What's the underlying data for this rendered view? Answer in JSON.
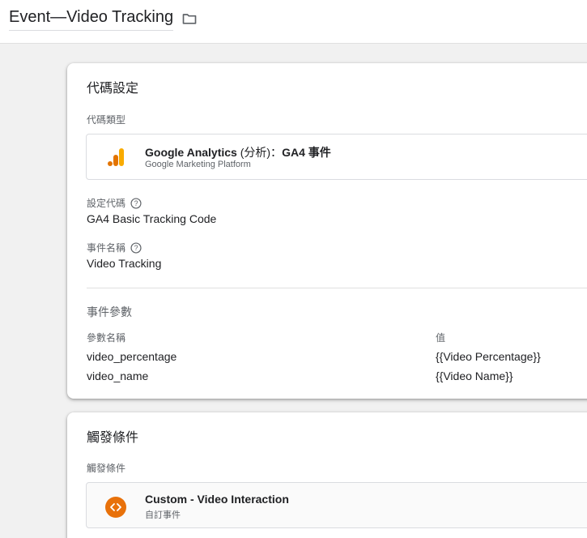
{
  "header": {
    "title": "Event—Video Tracking",
    "folder_icon": "folder-icon"
  },
  "tag_config": {
    "heading": "代碼設定",
    "type_label": "代碼類型",
    "type": {
      "name_bold_1": "Google Analytics ",
      "name_normal": "(分析)：",
      "name_bold_2": "GA4 事件",
      "platform": "Google Marketing Platform",
      "icon": "google-analytics-icon"
    },
    "config_tag_label": "設定代碼",
    "config_tag_value": "GA4 Basic Tracking Code",
    "event_name_label": "事件名稱",
    "event_name_value": "Video Tracking",
    "params": {
      "heading": "事件參數",
      "col_name": "參數名稱",
      "col_value": "值",
      "rows": [
        {
          "name": "video_percentage",
          "value": "{{Video Percentage}}"
        },
        {
          "name": "video_name",
          "value": "{{Video Name}}"
        }
      ]
    }
  },
  "triggering": {
    "heading": "觸發條件",
    "label": "觸發條件",
    "trigger": {
      "name": "Custom - Video Interaction",
      "type": "自訂事件",
      "icon": "custom-event-icon"
    }
  },
  "colors": {
    "ga_orange": "#f9ab00",
    "ga_dark_orange": "#e37400",
    "trigger_orange": "#e8710a"
  }
}
